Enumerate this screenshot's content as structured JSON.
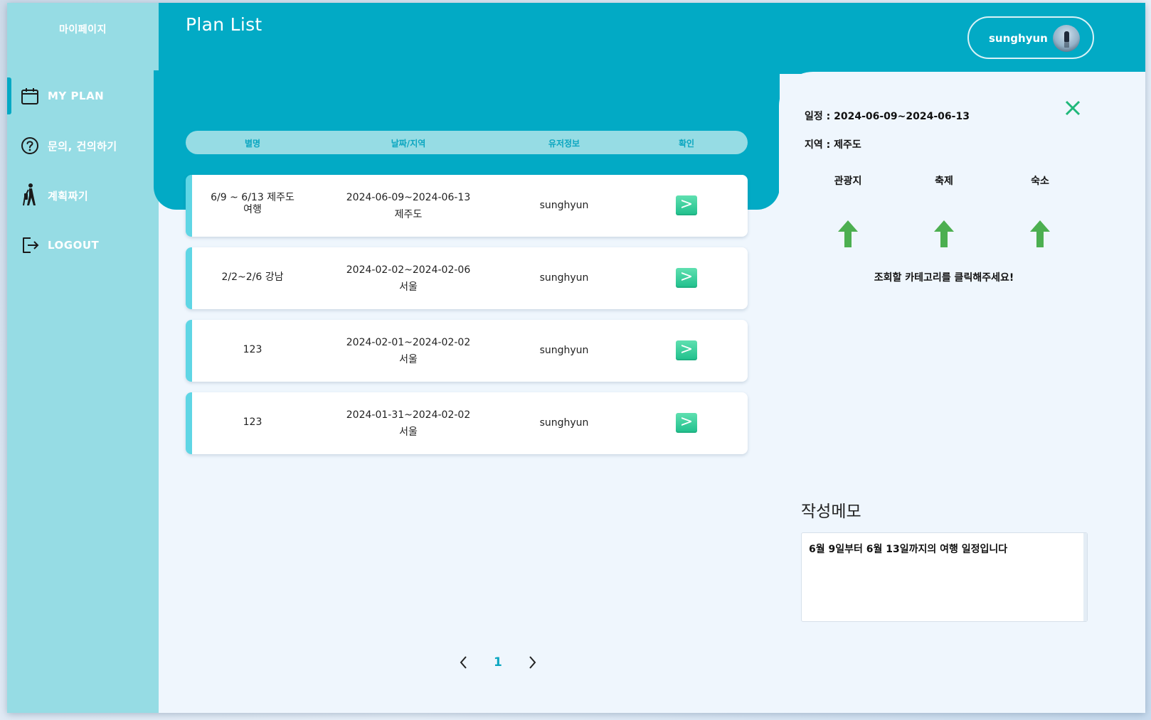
{
  "sidebar": {
    "brand": "마이페이지",
    "items": [
      {
        "label": "MY PLAN",
        "icon": "calendar-icon",
        "active": true
      },
      {
        "label": "문의, 건의하기",
        "icon": "question-circle-icon",
        "active": false
      },
      {
        "label": "계획짜기",
        "icon": "hiker-icon",
        "active": false
      },
      {
        "label": "LOGOUT",
        "icon": "logout-icon",
        "active": false
      }
    ]
  },
  "header": {
    "title": "Plan List",
    "user_name": "sunghyun"
  },
  "table": {
    "columns": [
      "별명",
      "날짜/지역",
      "유저정보",
      "확인"
    ],
    "rows": [
      {
        "nickname": "6/9 ~ 6/13 제주도",
        "nickname2": "여행",
        "dates": "2024-06-09~2024-06-13",
        "region": "제주도",
        "user": "sunghyun",
        "action": ">"
      },
      {
        "nickname": "2/2~2/6 강남",
        "nickname2": "",
        "dates": "2024-02-02~2024-02-06",
        "region": "서울",
        "user": "sunghyun",
        "action": ">"
      },
      {
        "nickname": "123",
        "nickname2": "",
        "dates": "2024-02-01~2024-02-02",
        "region": "서울",
        "user": "sunghyun",
        "action": ">"
      },
      {
        "nickname": "123",
        "nickname2": "",
        "dates": "2024-01-31~2024-02-02",
        "region": "서울",
        "user": "sunghyun",
        "action": ">"
      }
    ]
  },
  "pagination": {
    "prev": "prev-arrow-icon",
    "current": "1",
    "next": "next-arrow-icon"
  },
  "detail": {
    "schedule": "일정 : 2024-06-09~2024-06-13",
    "region": "지역 : 제주도",
    "categories": [
      "관광지",
      "축제",
      "숙소"
    ],
    "hint": "조회할 카테고리를 클릭해주세요!",
    "memo_title": "작성메모",
    "memo_text": "6월 9일부터 6월 13일까지의 여행 일정입니다"
  },
  "colors": {
    "primary": "#02aac5",
    "sidebar": "#96dce4",
    "accent_bar": "#5fd6e5",
    "button_green": "#1fbf8c",
    "arrow_green": "#4caf50",
    "close_green": "#1fb87a"
  }
}
